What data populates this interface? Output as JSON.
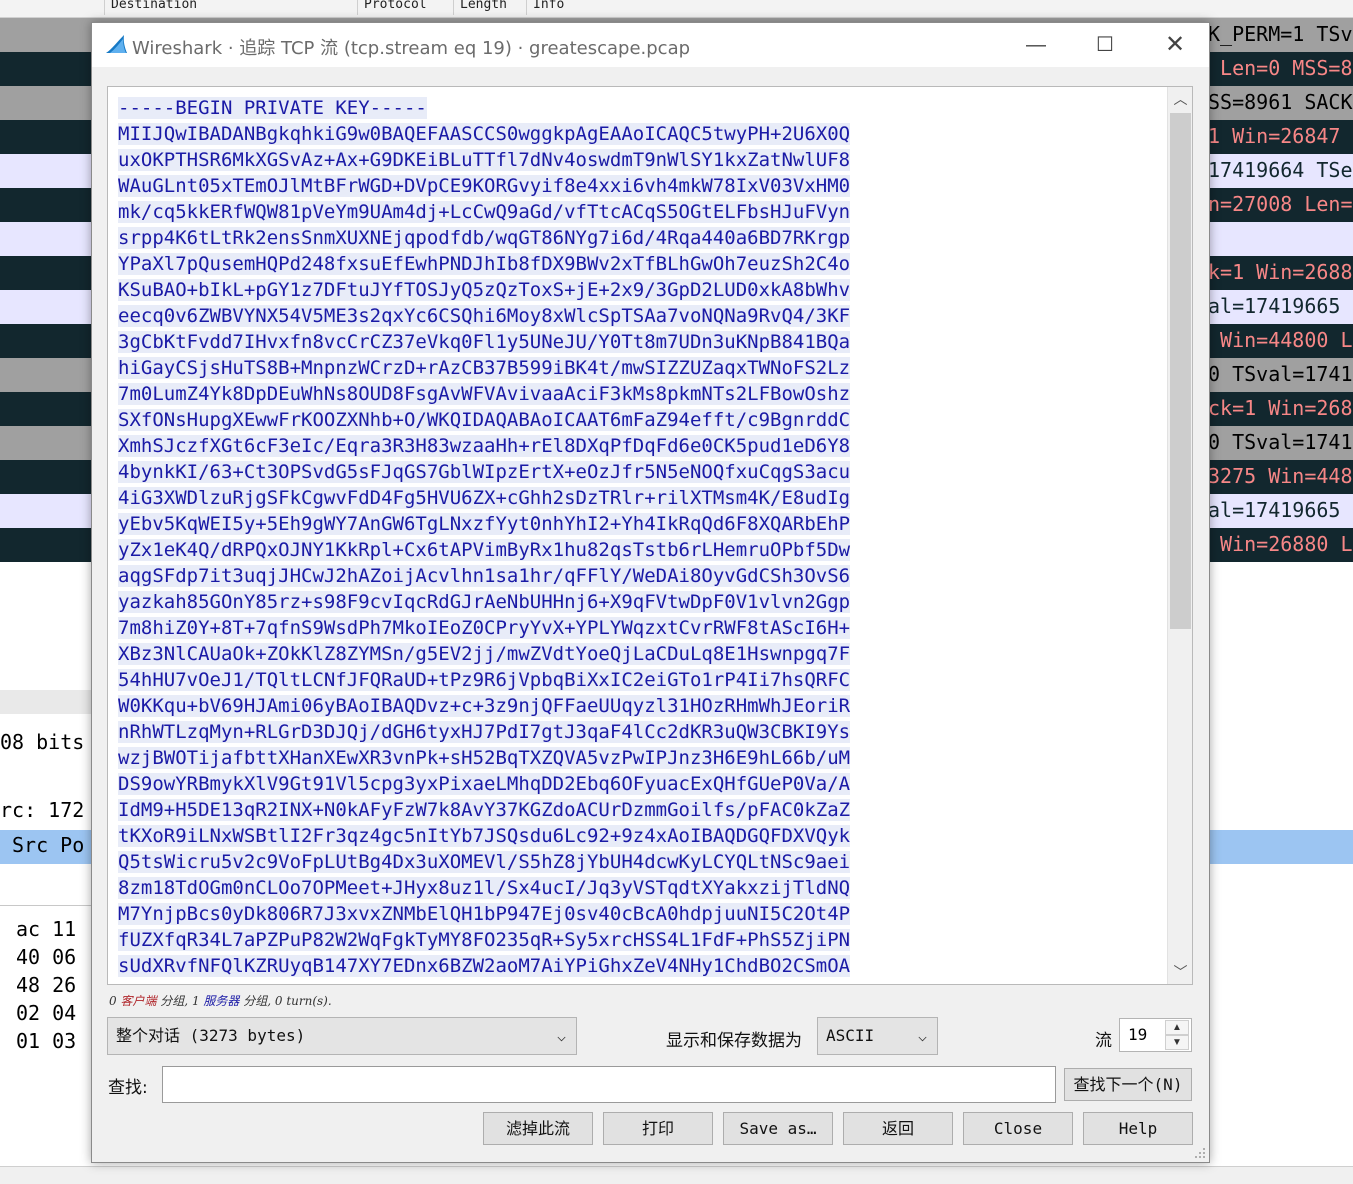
{
  "background": {
    "columns": [
      "Destination",
      "Protocol",
      "Length",
      "Info"
    ],
    "info_fragments": [
      {
        "text": "K_PERM=1 TSv",
        "bg": "#a0a0a0",
        "fg": "#000000"
      },
      {
        "text": " Len=0 MSS=8",
        "bg": "#12272e",
        "fg": "#f78787"
      },
      {
        "text": "SS=8961 SACK",
        "bg": "#a0a0a0",
        "fg": "#000000"
      },
      {
        "text": "1 Win=26847 ",
        "bg": "#12272e",
        "fg": "#f78787"
      },
      {
        "text": "17419664 TSe",
        "bg": "#e7e6ff",
        "fg": "#12272e"
      },
      {
        "text": "n=27008 Len=",
        "bg": "#12272e",
        "fg": "#f78787"
      },
      {
        "text": "",
        "bg": "#e7e6ff",
        "fg": "#12272e"
      },
      {
        "text": "k=1 Win=2688",
        "bg": "#12272e",
        "fg": "#f78787"
      },
      {
        "text": "al=17419665 ",
        "bg": "#e7e6ff",
        "fg": "#12272e"
      },
      {
        "text": " Win=44800 L",
        "bg": "#12272e",
        "fg": "#f78787"
      },
      {
        "text": "0 TSval=1741",
        "bg": "#a0a0a0",
        "fg": "#000000"
      },
      {
        "text": "ck=1 Win=268",
        "bg": "#12272e",
        "fg": "#f78787"
      },
      {
        "text": "0 TSval=1741",
        "bg": "#a0a0a0",
        "fg": "#000000"
      },
      {
        "text": "3275 Win=448",
        "bg": "#12272e",
        "fg": "#f78787"
      },
      {
        "text": "al=17419665 ",
        "bg": "#e7e6ff",
        "fg": "#12272e"
      },
      {
        "text": " Win=26880 L",
        "bg": "#12272e",
        "fg": "#f78787"
      }
    ],
    "detail_lines": [
      "08 bits",
      "rc: 172",
      "Src Po"
    ],
    "hex_lines": [
      "ac 11",
      "40 06",
      "48 26",
      "02 04",
      "01 03"
    ]
  },
  "dialog": {
    "title": "Wireshark · 追踪 TCP 流 (tcp.stream eq 19) · greatescape.pcap",
    "stream_text": [
      "-----BEGIN PRIVATE KEY-----",
      "MIIJQwIBADANBgkqhkiG9w0BAQEFAASCCS0wggkpAgEAAoICAQC5twyPH+2U6X0Q",
      "uxOKPTHSR6MkXGSvAz+Ax+G9DKEiBLuTTfl7dNv4oswdmT9nWlSY1kxZatNwlUF8",
      "WAuGLnt05xTEmOJlMtBFrWGD+DVpCE9KORGvyif8e4xxi6vh4mkW78IxV03VxHM0",
      "mk/cq5kkERfWQW81pVeYm9UAm4dj+LcCwQ9aGd/vfTtcACqS5OGtELFbsHJuFVyn",
      "srpp4K6tLtRk2ensSnmXUXNEjqpodfdb/wqGT86NYg7i6d/4Rqa440a6BD7RKrgp",
      "YPaXl7pQusemHQPd248fxsuEfEwhPNDJhIb8fDX9BWv2xTfBLhGwOh7euzSh2C4o",
      "KSuBAO+bIkL+pGY1z7DFtuJYfTOSJyQ5zQzToxS+jE+2x9/3GpD2LUD0xkA8bWhv",
      "eecq0v6ZWBVYNX54V5ME3s2qxYc6CSQhi6Moy8xWlcSpTSAa7voNQNa9RvQ4/3KF",
      "3gCbKtFvdd7IHvxfn8vcCrCZ37eVkq0Fl1y5UNeJU/Y0Tt8m7UDn3uKNpB841BQa",
      "hiGayCSjsHuTS8B+MnpnzWCrzD+rAzCB37B599iBK4t/mwSIZZUZaqxTWNoFS2Lz",
      "7m0LumZ4Yk8DpDEuWhNs8OUD8FsgAvWFVAvivaaAciF3kMs8pkmNTs2LFBowOshz",
      "SXfONsHupgXEwwFrKOOZXNhb+O/WKQIDAQABAoICAAT6mFaZ94efft/c9BgnrddC",
      "XmhSJczfXGt6cF3eIc/Eqra3R3H83wzaaHh+rEl8DXqPfDqFd6e0CK5pud1eD6Y8",
      "4bynkKI/63+Ct3OPSvdG5sFJqGS7GblWIpzErtX+eOzJfr5N5eNOQfxuCqgS3acu",
      "4iG3XWDlzuRjgSFkCgwvFdD4Fg5HVU6ZX+cGhh2sDzTRlr+rilXTMsm4K/E8udIg",
      "yEbv5KqWEI5y+5Eh9gWY7AnGW6TgLNxzfYyt0nhYhI2+Yh4IkRqQd6F8XQARbEhP",
      "yZx1eK4Q/dRPQxOJNY1KkRpl+Cx6tAPVimByRx1hu82qsTstb6rLHemruOPbf5Dw",
      "aqgSFdp7it3uqjJHCwJ2hAZoijAcvlhn1sa1hr/qFFlY/WeDAi8OyvGdCSh3OvS6",
      "yazkah85GOnY85rz+s98F9cvIqcRdGJrAeNbUHHnj6+X9qFVtwDpF0V1vlvn2Ggp",
      "7m8hiZ0Y+8T+7qfnS9WsdPh7MkoIEoZ0CPryYvX+YPLYWqzxtCvrRWF8tAScI6H+",
      "XBz3NlCAUaOk+ZOkKlZ8ZYMSn/g5EV2jj/mwZVdtYoeQjLaCDuLq8E1Hswnpgq7F",
      "54hHU7vOeJ1/TQltLCNfJFQRaUD+tPz9R6jVpbqBiXxIC2eiGTo1rP4Ii7hsQRFC",
      "W0KKqu+bV69HJAmi06yBAoIBAQDvz+c+3z9njQFFaeUUqyzl31HOzRHmWhJEoriR",
      "nRhWTLzqMyn+RLGrD3DJQj/dGH6tyxHJ7PdI7gtJ3qaF4lCc2dKR3uQW3CBKI9Ys",
      "wzjBWOTijafbttXHanXEwXR3vnPk+sH52BqTXZQVA5vzPwIPJnz3H6E9hL66b/uM",
      "DS9owYRBmykXlV9Gt91Vl5cpg3yxPixaeLMhqDD2Ebq6OFyuacExQHfGUeP0Va/A",
      "IdM9+H5DE13qR2INX+N0kAFyFzW7k8AvY37KGZdoACUrDzmmGoilfs/pFAC0kZaZ",
      "tKXoR9iLNxWSBtlI2Fr3qz4gc5nItYb7JSQsdu6Lc92+9z4xAoIBAQDGQFDXVQyk",
      "Q5tsWicru5v2c9VoFpLUtBg4Dx3uXOMEVl/S5hZ8jYbUH4dcwKyLCYQLtNSc9aei",
      "8zm18TdOGm0nCLOo7OPMeet+JHyx8uz1l/Sx4ucI/Jq3yVSTqdtXYakxzijTldNQ",
      "M7YnjpBcs0yDk806R7J3xvxZNMbElQH1bP947Ej0sv40cBcA0hdpjuuNI5C2Ot4P",
      "fUZXfqR34L7aPZPuP82W2WqFgkTyMY8FO235qR+Sy5xrcHSS4L1FdF+PhS5ZjiPN",
      "sUdXRvfNFQlKZRUyqB147XY7EDnx6BZW2aoM7AiYPiGhxZeV4NHy1ChdBO2CSmOA"
    ],
    "status": {
      "client_count": "0",
      "client_label": "客户端",
      "sep1": " 分组, ",
      "server_count": "1",
      "server_label": "服务器",
      "tail": " 分组, 0 turn(s)."
    },
    "conversation_select": "整个对话 (3273 bytes)",
    "format_label": "显示和保存数据为",
    "format_select": "ASCII",
    "stream_label": "流",
    "stream_value": "19",
    "find_label": "查找:",
    "find_value": "",
    "buttons": {
      "find_next": "查找下一个(N)",
      "filter_out": "滤掉此流",
      "print": "打印",
      "save_as": "Save as…",
      "back": "返回",
      "close": "Close",
      "help": "Help"
    }
  }
}
